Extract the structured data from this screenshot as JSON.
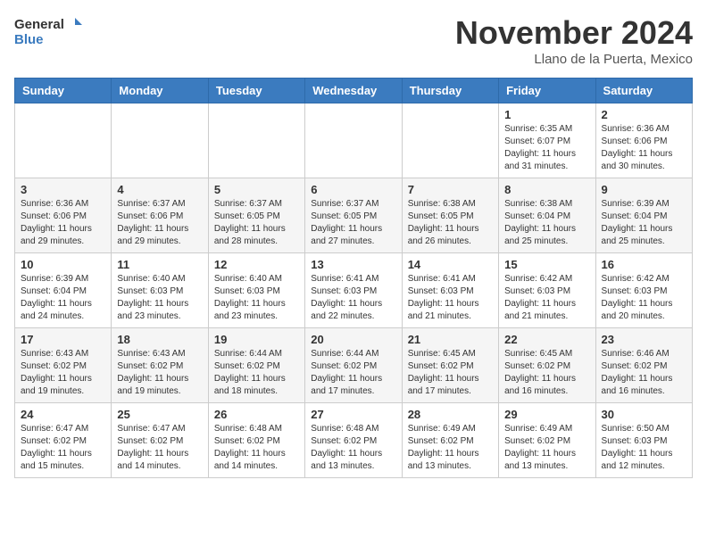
{
  "header": {
    "logo_line1": "General",
    "logo_line2": "Blue",
    "month": "November 2024",
    "location": "Llano de la Puerta, Mexico"
  },
  "days_of_week": [
    "Sunday",
    "Monday",
    "Tuesday",
    "Wednesday",
    "Thursday",
    "Friday",
    "Saturday"
  ],
  "weeks": [
    [
      {
        "day": "",
        "info": ""
      },
      {
        "day": "",
        "info": ""
      },
      {
        "day": "",
        "info": ""
      },
      {
        "day": "",
        "info": ""
      },
      {
        "day": "",
        "info": ""
      },
      {
        "day": "1",
        "info": "Sunrise: 6:35 AM\nSunset: 6:07 PM\nDaylight: 11 hours and 31 minutes."
      },
      {
        "day": "2",
        "info": "Sunrise: 6:36 AM\nSunset: 6:06 PM\nDaylight: 11 hours and 30 minutes."
      }
    ],
    [
      {
        "day": "3",
        "info": "Sunrise: 6:36 AM\nSunset: 6:06 PM\nDaylight: 11 hours and 29 minutes."
      },
      {
        "day": "4",
        "info": "Sunrise: 6:37 AM\nSunset: 6:06 PM\nDaylight: 11 hours and 29 minutes."
      },
      {
        "day": "5",
        "info": "Sunrise: 6:37 AM\nSunset: 6:05 PM\nDaylight: 11 hours and 28 minutes."
      },
      {
        "day": "6",
        "info": "Sunrise: 6:37 AM\nSunset: 6:05 PM\nDaylight: 11 hours and 27 minutes."
      },
      {
        "day": "7",
        "info": "Sunrise: 6:38 AM\nSunset: 6:05 PM\nDaylight: 11 hours and 26 minutes."
      },
      {
        "day": "8",
        "info": "Sunrise: 6:38 AM\nSunset: 6:04 PM\nDaylight: 11 hours and 25 minutes."
      },
      {
        "day": "9",
        "info": "Sunrise: 6:39 AM\nSunset: 6:04 PM\nDaylight: 11 hours and 25 minutes."
      }
    ],
    [
      {
        "day": "10",
        "info": "Sunrise: 6:39 AM\nSunset: 6:04 PM\nDaylight: 11 hours and 24 minutes."
      },
      {
        "day": "11",
        "info": "Sunrise: 6:40 AM\nSunset: 6:03 PM\nDaylight: 11 hours and 23 minutes."
      },
      {
        "day": "12",
        "info": "Sunrise: 6:40 AM\nSunset: 6:03 PM\nDaylight: 11 hours and 23 minutes."
      },
      {
        "day": "13",
        "info": "Sunrise: 6:41 AM\nSunset: 6:03 PM\nDaylight: 11 hours and 22 minutes."
      },
      {
        "day": "14",
        "info": "Sunrise: 6:41 AM\nSunset: 6:03 PM\nDaylight: 11 hours and 21 minutes."
      },
      {
        "day": "15",
        "info": "Sunrise: 6:42 AM\nSunset: 6:03 PM\nDaylight: 11 hours and 21 minutes."
      },
      {
        "day": "16",
        "info": "Sunrise: 6:42 AM\nSunset: 6:03 PM\nDaylight: 11 hours and 20 minutes."
      }
    ],
    [
      {
        "day": "17",
        "info": "Sunrise: 6:43 AM\nSunset: 6:02 PM\nDaylight: 11 hours and 19 minutes."
      },
      {
        "day": "18",
        "info": "Sunrise: 6:43 AM\nSunset: 6:02 PM\nDaylight: 11 hours and 19 minutes."
      },
      {
        "day": "19",
        "info": "Sunrise: 6:44 AM\nSunset: 6:02 PM\nDaylight: 11 hours and 18 minutes."
      },
      {
        "day": "20",
        "info": "Sunrise: 6:44 AM\nSunset: 6:02 PM\nDaylight: 11 hours and 17 minutes."
      },
      {
        "day": "21",
        "info": "Sunrise: 6:45 AM\nSunset: 6:02 PM\nDaylight: 11 hours and 17 minutes."
      },
      {
        "day": "22",
        "info": "Sunrise: 6:45 AM\nSunset: 6:02 PM\nDaylight: 11 hours and 16 minutes."
      },
      {
        "day": "23",
        "info": "Sunrise: 6:46 AM\nSunset: 6:02 PM\nDaylight: 11 hours and 16 minutes."
      }
    ],
    [
      {
        "day": "24",
        "info": "Sunrise: 6:47 AM\nSunset: 6:02 PM\nDaylight: 11 hours and 15 minutes."
      },
      {
        "day": "25",
        "info": "Sunrise: 6:47 AM\nSunset: 6:02 PM\nDaylight: 11 hours and 14 minutes."
      },
      {
        "day": "26",
        "info": "Sunrise: 6:48 AM\nSunset: 6:02 PM\nDaylight: 11 hours and 14 minutes."
      },
      {
        "day": "27",
        "info": "Sunrise: 6:48 AM\nSunset: 6:02 PM\nDaylight: 11 hours and 13 minutes."
      },
      {
        "day": "28",
        "info": "Sunrise: 6:49 AM\nSunset: 6:02 PM\nDaylight: 11 hours and 13 minutes."
      },
      {
        "day": "29",
        "info": "Sunrise: 6:49 AM\nSunset: 6:02 PM\nDaylight: 11 hours and 13 minutes."
      },
      {
        "day": "30",
        "info": "Sunrise: 6:50 AM\nSunset: 6:03 PM\nDaylight: 11 hours and 12 minutes."
      }
    ]
  ]
}
